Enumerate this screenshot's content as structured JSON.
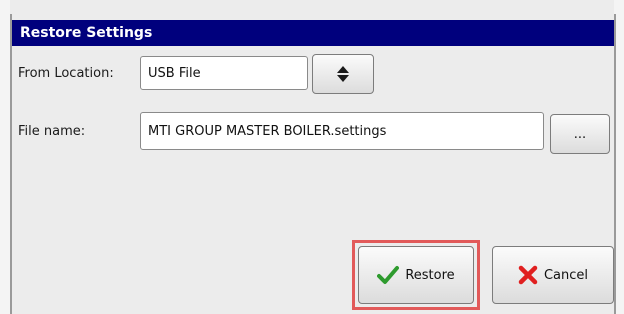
{
  "dialog": {
    "title": "Restore Settings"
  },
  "form": {
    "from_location_label": "From Location:",
    "from_location_value": "USB File",
    "file_name_label": "File name:",
    "file_name_value": "MTI GROUP MASTER BOILER.settings",
    "browse_label": "..."
  },
  "actions": {
    "restore_label": "Restore",
    "cancel_label": "Cancel"
  },
  "icons": {
    "stepper": "up-down-arrows-icon",
    "restore": "check-icon",
    "cancel": "x-icon"
  },
  "colors": {
    "title_bar": "#00007d",
    "check": "#2e9b2e",
    "x": "#e02020",
    "highlight": "#e25a5a"
  }
}
